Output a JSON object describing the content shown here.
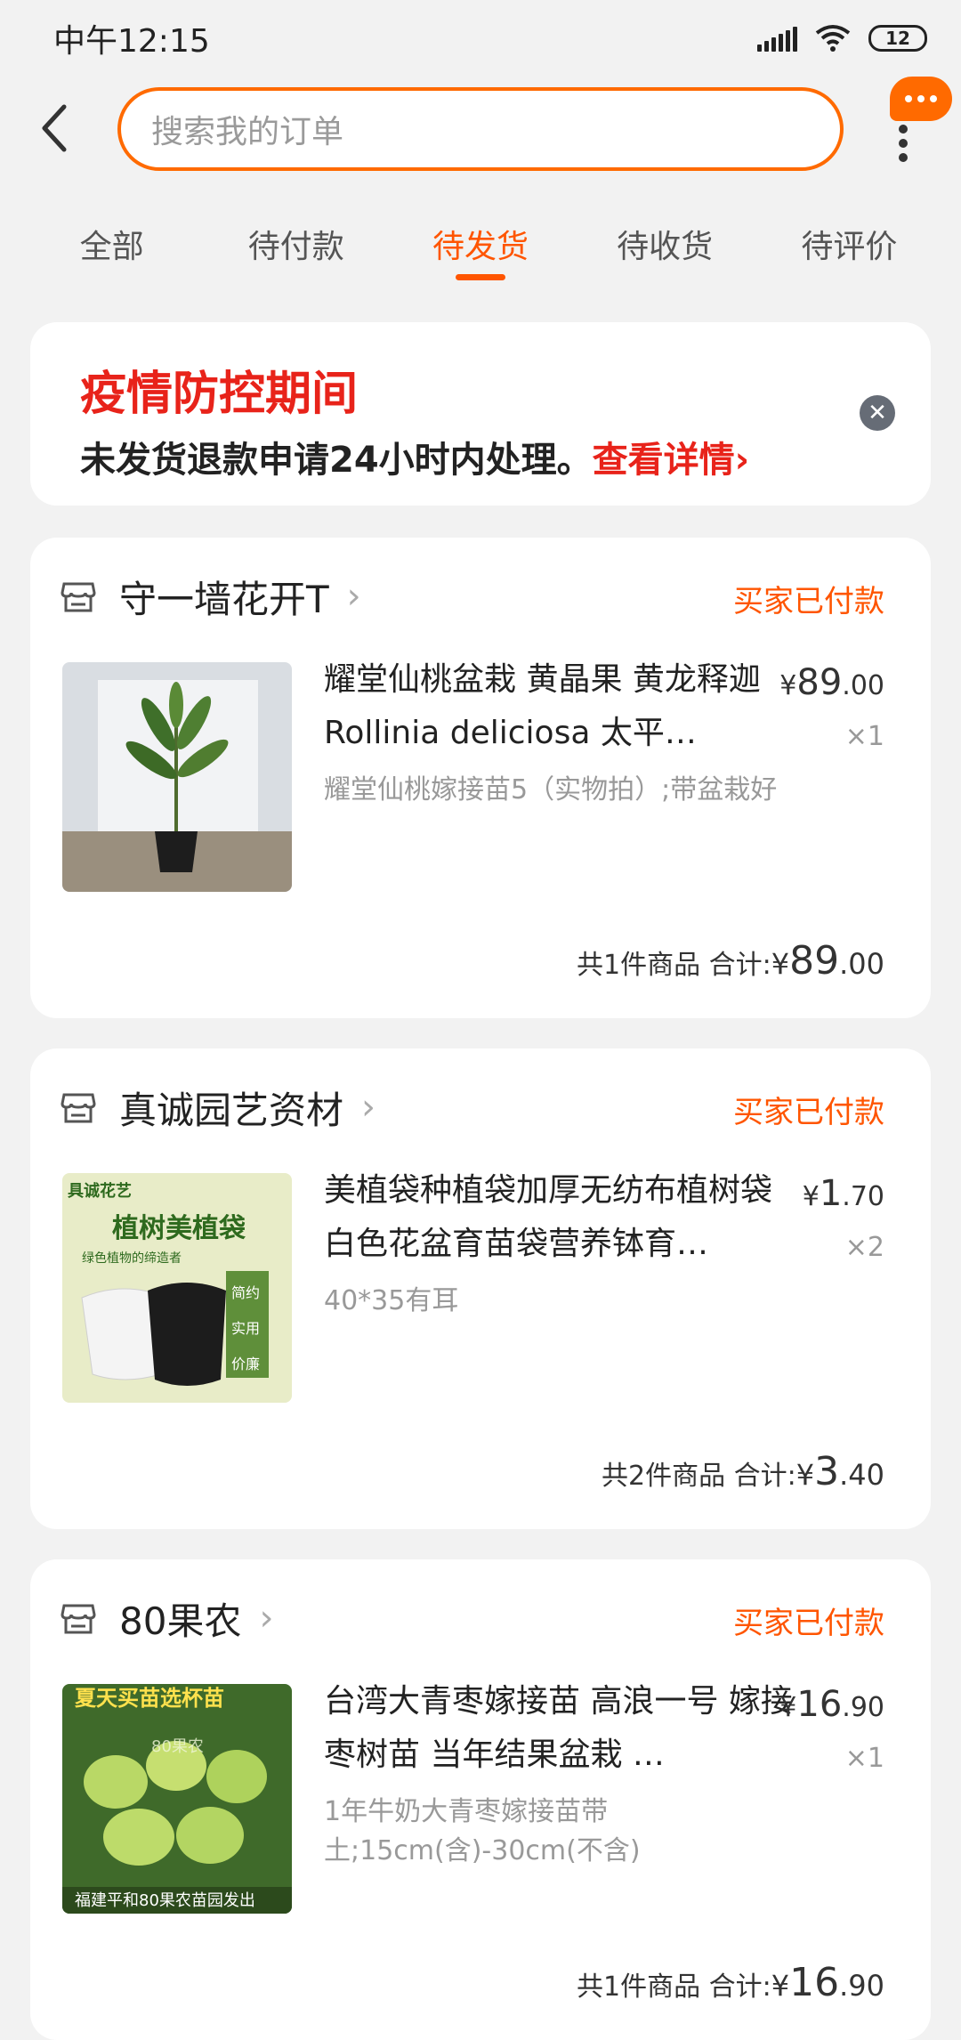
{
  "status": {
    "time": "中午12:15",
    "battery": "12"
  },
  "search": {
    "placeholder": "搜索我的订单"
  },
  "tabs": [
    {
      "label": "全部"
    },
    {
      "label": "待付款"
    },
    {
      "label": "待发货",
      "active": true
    },
    {
      "label": "待收货"
    },
    {
      "label": "待评价"
    }
  ],
  "notice": {
    "title": "疫情防控期间",
    "body": "未发货退款申请24小时内处理。",
    "link": "查看详情",
    "link_arrow": "›"
  },
  "orders": [
    {
      "shop": "守一墙花开T",
      "status": "买家已付款",
      "title": "耀堂仙桃盆栽  黄晶果 黄龙释迦Rollinia deliciosa 太平…",
      "sku": "耀堂仙桃嫁接苗5（实物拍）;带盆栽好",
      "price_currency": "¥",
      "price_int": "89",
      "price_dec": ".00",
      "qty": "×1",
      "count_text": "共1件商品",
      "total_label": "合计:",
      "total_currency": "¥",
      "total_int": "89",
      "total_dec": ".00"
    },
    {
      "shop": "真诚园艺资材",
      "status": "买家已付款",
      "title": "美植袋种植袋加厚无纺布植树袋白色花盆育苗袋营养钵育…",
      "sku": "40*35有耳",
      "price_currency": "¥",
      "price_int": "1",
      "price_dec": ".70",
      "qty": "×2",
      "count_text": "共2件商品",
      "total_label": "合计:",
      "total_currency": "¥",
      "total_int": "3",
      "total_dec": ".40"
    },
    {
      "shop": "80果农",
      "status": "买家已付款",
      "title": "台湾大青枣嫁接苗 高浪一号 嫁接枣树苗 当年结果盆栽 …",
      "sku": "1年牛奶大青枣嫁接苗带土;15cm(含)-30cm(不含)",
      "price_currency": "¥",
      "price_int": "16",
      "price_dec": ".90",
      "qty": "×1",
      "count_text": "共1件商品",
      "total_label": "合计:",
      "total_currency": "¥",
      "total_int": "16",
      "total_dec": ".90"
    }
  ],
  "thumb_texts": {
    "t2_brand": "具诚花艺",
    "t2_title": "植树美植袋",
    "t2_sub": "绿色植物的缔造者",
    "t2_tags": [
      "简约",
      "实用",
      "价廉"
    ],
    "t3_banner": "夏天买苗选杯苗",
    "t3_watermark": "80果农",
    "t3_footer": "福建平和80果农苗园发出"
  },
  "colors": {
    "accent": "#ff5500",
    "search_border": "#ff6a00",
    "notice_red": "#e8231a"
  }
}
